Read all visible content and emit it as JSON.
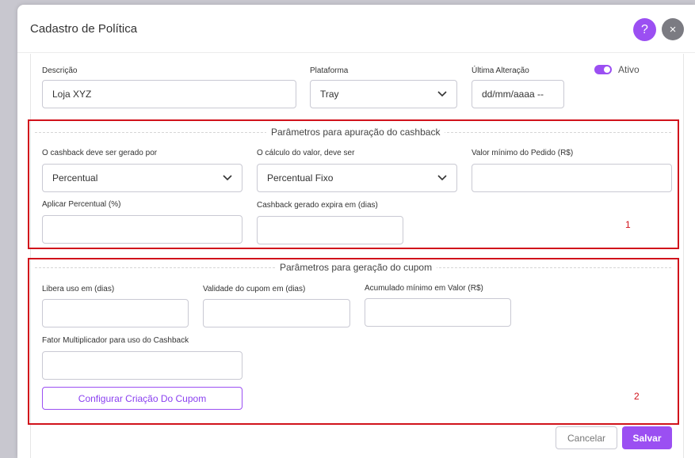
{
  "modal": {
    "title": "Cadastro de Política",
    "help_glyph": "?",
    "close_glyph": "×",
    "accent_color": "#9b4ff2",
    "highlight_color": "#d1121b"
  },
  "general": {
    "descricao": {
      "label": "Descrição",
      "value": "Loja XYZ"
    },
    "plataforma": {
      "label": "Plataforma",
      "value": "Tray"
    },
    "ultima_alteracao": {
      "label": "Última Alteração",
      "value": "dd/mm/aaaa --"
    },
    "ativo": {
      "label": "Ativo",
      "checked": true
    }
  },
  "cashback_section": {
    "legend": "Parâmetros para apuração do cashback",
    "marker": "1",
    "gerado_por": {
      "label": "O cashback deve ser gerado por",
      "value": "Percentual"
    },
    "calculo_valor": {
      "label": "O cálculo do valor, deve ser",
      "value": "Percentual Fixo"
    },
    "valor_minimo": {
      "label": "Valor mínimo do Pedido (R$)",
      "value": ""
    },
    "aplicar_percentual": {
      "label": "Aplicar Percentual (%)",
      "value": ""
    },
    "expira_em": {
      "label": "Cashback gerado expira em (dias)",
      "value": ""
    }
  },
  "cupom_section": {
    "legend": "Parâmetros para geração do cupom",
    "marker": "2",
    "libera_uso": {
      "label": "Libera uso em (dias)",
      "value": ""
    },
    "validade": {
      "label": "Validade do cupom em (dias)",
      "value": ""
    },
    "acumulado_minimo": {
      "label": "Acumulado mínimo em Valor (R$)",
      "value": ""
    },
    "fator_multiplicador": {
      "label": "Fator Multiplicador para uso do Cashback",
      "value": ""
    },
    "configurar_button": "Configurar Criação Do Cupom"
  },
  "footer": {
    "cancel_label": "Cancelar",
    "save_label": "Salvar"
  }
}
